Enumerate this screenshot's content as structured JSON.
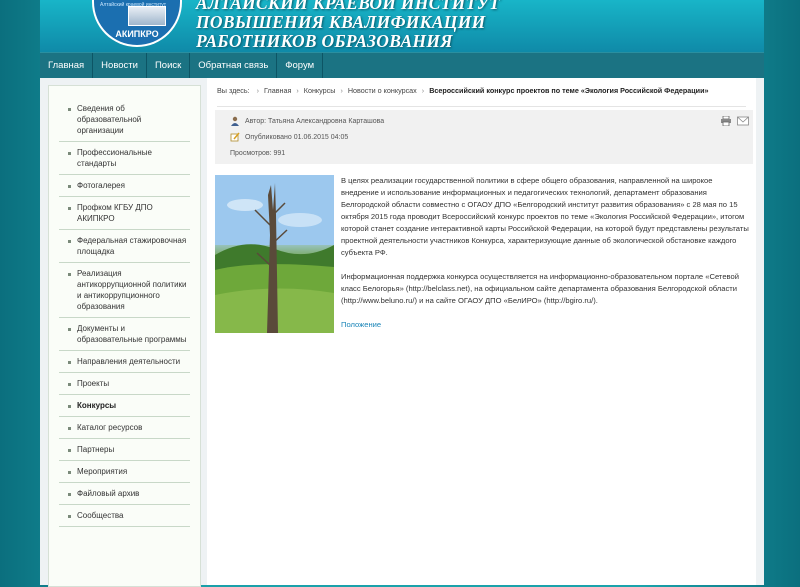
{
  "header": {
    "title_lines": [
      "АЛТАЙСКИЙ КРАЕВОЙ ИНСТИТУТ",
      "ПОВЫШЕНИЯ КВАЛИФИКАЦИИ",
      "РАБОТНИКОВ ОБРАЗОВАНИЯ"
    ],
    "logo_text": "АКИПКРО",
    "logo_small": "Алтайский краевой институт"
  },
  "nav": [
    "Главная",
    "Новости",
    "Поиск",
    "Обратная связь",
    "Форум"
  ],
  "sidebar": [
    {
      "label": "Сведения об образовательной организации",
      "active": false
    },
    {
      "label": "Профессиональные стандарты",
      "active": false
    },
    {
      "label": "Фотогалерея",
      "active": false
    },
    {
      "label": "Профком КГБУ ДПО АКИПКРО",
      "active": false
    },
    {
      "label": "Федеральная стажировочная площадка",
      "active": false
    },
    {
      "label": "Реализация антикоррупционной политики и антикоррупционного образования",
      "active": false
    },
    {
      "label": "Документы и образовательные программы",
      "active": false
    },
    {
      "label": "Направления деятельности",
      "active": false
    },
    {
      "label": "Проекты",
      "active": false
    },
    {
      "label": "Конкурсы",
      "active": true
    },
    {
      "label": "Каталог ресурсов",
      "active": false
    },
    {
      "label": "Партнеры",
      "active": false
    },
    {
      "label": "Мероприятия",
      "active": false
    },
    {
      "label": "Файловый архив",
      "active": false
    },
    {
      "label": "Сообщества",
      "active": false
    }
  ],
  "breadcrumb": {
    "prefix": "Вы здесь:",
    "items": [
      "Главная",
      "Конкурсы",
      "Новости о конкурсах"
    ],
    "current": "Всероссийский конкурс проектов по теме «Экология Российской Федерации»"
  },
  "meta": {
    "author": "Автор: Татьяна Александровна Карташова",
    "published": "Опубликовано 01.06.2015 04:05",
    "views": "Просмотров: 991"
  },
  "article": {
    "p1": "В целях реализации государственной политики в сфере общего образования, направленной на широкое внедрение и использование информационных и педагогических технологий, департамент образования Белгородской области совместно с ОГАОУ ДПО «Белгородский институт развития образования» с 28 мая по 15 октября 2015 года проводит Всероссийский конкурс проектов по теме «Экология Российской Федерации», итогом которой станет создание интерактивной карты Российской Федерации, на которой будут представлены результаты проектной деятельности участников Конкурса, характеризующие данные об экологической обстановке каждого субъекта РФ.",
    "p2": "Информационная поддержка конкурса осуществляется на информационно-образовательном портале «Сетевой класс Белогорья» (http://belclass.net), на официальном сайте департамента образования Белгородской области (http://www.beluno.ru/) и на сайте ОГАОУ ДПО «БелИРО» (http://bgiro.ru/).",
    "attachment": "Положение"
  }
}
